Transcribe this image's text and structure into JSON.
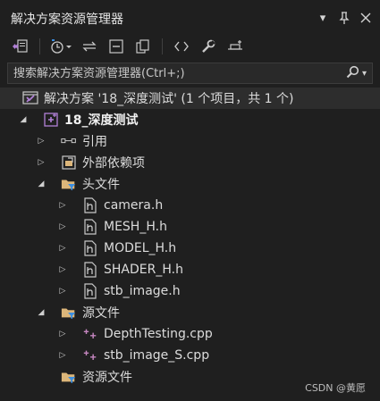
{
  "window": {
    "title": "解决方案资源管理器",
    "controls": [
      "chevron-down-icon",
      "pin-icon",
      "close-icon"
    ]
  },
  "toolbar": {
    "buttons": [
      "solution-switch-icon",
      "history-icon",
      "sync-icon",
      "collapse-all-icon",
      "show-all-files-icon",
      "view-code-icon",
      "properties-wrench-icon",
      "preview-icon"
    ]
  },
  "search": {
    "placeholder": "搜索解决方案资源管理器(Ctrl+;)"
  },
  "tree": {
    "solution": "解决方案 '18_深度测试' (1 个项目，共 1 个)",
    "project": "18_深度测试",
    "references": "引用",
    "external_dependencies": "外部依赖项",
    "header_folder": "头文件",
    "headers": [
      "camera.h",
      "MESH_H.h",
      "MODEL_H.h",
      "SHADER_H.h",
      "stb_image.h"
    ],
    "source_folder": "源文件",
    "sources": [
      "DepthTesting.cpp",
      "stb_image_S.cpp"
    ],
    "resource_folder": "资源文件"
  },
  "watermark": "CSDN @黄愿",
  "colors": {
    "background": "#1f1f1f",
    "selected_row": "#2d2d2d",
    "vs_purple": "#b180d7",
    "folder_yellow": "#dcb67a",
    "filter_blue": "#3c8ee0",
    "cpp_pink": "#c586c0"
  }
}
